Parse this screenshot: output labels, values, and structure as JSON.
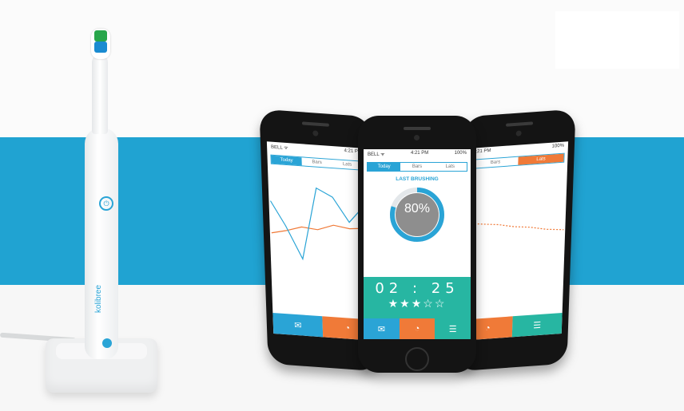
{
  "scene": {
    "band_color": "#20a3d2",
    "toothbrush": {
      "brand_text": "kolibree",
      "icons": [
        "power-icon"
      ]
    }
  },
  "phones": {
    "left": {
      "status_left": "BELL ᯤ",
      "status_time": "4:21 PM",
      "tabs": [
        "Today",
        "Bars",
        "Lats"
      ]
    },
    "middle": {
      "status_left": "BELL ᯤ",
      "status_time": "4:21 PM",
      "status_right": "100%",
      "tabs": [
        "Today",
        "Bars",
        "Lats"
      ],
      "heading": "LAST BRUSHING",
      "percent": "80%",
      "timer": "02 : 25",
      "stars": "★★★☆☆",
      "rating": 3,
      "nav_icons": [
        "mail-icon",
        "pie-chart-icon",
        "list-icon"
      ]
    },
    "right": {
      "status_time": "4:21 PM",
      "status_right": "100%",
      "tabs": [
        "Bars",
        "Lats"
      ]
    }
  }
}
